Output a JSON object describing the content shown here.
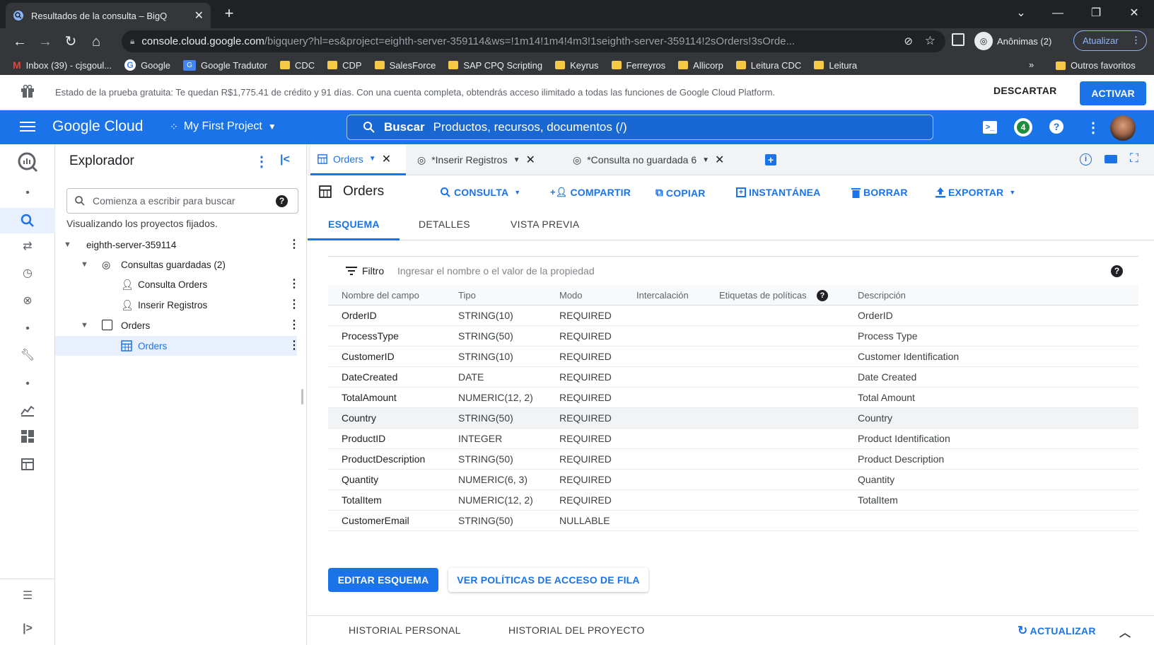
{
  "browser": {
    "tab_title": "Resultados de la consulta – BigQ",
    "url_host": "console.cloud.google.com",
    "url_path": "/bigquery?hl=es&project=eighth-server-359114&ws=!1m14!1m4!4m3!1seighth-server-359114!2sOrders!3sOrde...",
    "incognito_label": "Anônimas (2)",
    "update_label": "Atualizar",
    "bookmarks": [
      {
        "label": "Inbox (39) - cjsgoul...",
        "icon": "gmail-icon"
      },
      {
        "label": "Google",
        "icon": "google-icon"
      },
      {
        "label": "Google Tradutor",
        "icon": "translate-icon"
      },
      {
        "label": "CDC",
        "icon": "folder-icon"
      },
      {
        "label": "CDP",
        "icon": "folder-icon"
      },
      {
        "label": "SalesForce",
        "icon": "folder-icon"
      },
      {
        "label": "SAP CPQ Scripting",
        "icon": "folder-icon"
      },
      {
        "label": "Keyrus",
        "icon": "folder-icon"
      },
      {
        "label": "Ferreyros",
        "icon": "folder-icon"
      },
      {
        "label": "Allicorp",
        "icon": "folder-icon"
      },
      {
        "label": "Leitura CDC",
        "icon": "folder-icon"
      },
      {
        "label": "Leitura",
        "icon": "folder-icon"
      }
    ],
    "bookmarks_more": "»",
    "other_bookmarks": "Outros favoritos"
  },
  "banner": {
    "text": "Estado de la prueba gratuita: Te quedan R$1,775.41 de crédito y 91 días. Con una cuenta completa, obtendrás acceso ilimitado a todas las funciones de Google Cloud Platform.",
    "dismiss_label": "DESCARTAR",
    "activate_label": "ACTIVAR"
  },
  "header": {
    "brand": "Google Cloud",
    "project": "My First Project",
    "search_label": "Buscar",
    "search_placeholder": "Productos, recursos, documentos (/)",
    "notification_count": "4"
  },
  "explorer": {
    "title": "Explorador",
    "search_placeholder": "Comienza a escribir para buscar",
    "note": "Visualizando los proyectos fijados.",
    "project": "eighth-server-359114",
    "saved_queries_label": "Consultas guardadas (2)",
    "saved_queries": [
      "Consulta Orders",
      "Inserir Registros"
    ],
    "dataset": "Orders",
    "table": "Orders"
  },
  "tabs": [
    {
      "label": "Orders"
    },
    {
      "label": "*Inserir Registros"
    },
    {
      "label": "*Consulta no guardada 6"
    }
  ],
  "table_view": {
    "title": "Orders",
    "actions": {
      "query": "CONSULTA",
      "share": "COMPARTIR",
      "copy": "COPIAR",
      "snapshot": "INSTANTÁNEA",
      "delete": "BORRAR",
      "export": "EXPORTAR"
    },
    "subtabs": [
      "ESQUEMA",
      "DETALLES",
      "VISTA PREVIA"
    ],
    "filter_label": "Filtro",
    "filter_placeholder": "Ingresar el nombre o el valor de la propiedad",
    "columns": [
      "Nombre del campo",
      "Tipo",
      "Modo",
      "Intercalación",
      "Etiquetas de políticas",
      "Descripción"
    ],
    "rows": [
      {
        "name": "OrderID",
        "type": "STRING(10)",
        "mode": "REQUIRED",
        "desc": "OrderID"
      },
      {
        "name": "ProcessType",
        "type": "STRING(50)",
        "mode": "REQUIRED",
        "desc": "Process Type"
      },
      {
        "name": "CustomerID",
        "type": "STRING(10)",
        "mode": "REQUIRED",
        "desc": "Customer Identification"
      },
      {
        "name": "DateCreated",
        "type": "DATE",
        "mode": "REQUIRED",
        "desc": "Date Created"
      },
      {
        "name": "TotalAmount",
        "type": "NUMERIC(12, 2)",
        "mode": "REQUIRED",
        "desc": "Total Amount"
      },
      {
        "name": "Country",
        "type": "STRING(50)",
        "mode": "REQUIRED",
        "desc": "Country"
      },
      {
        "name": "ProductID",
        "type": "INTEGER",
        "mode": "REQUIRED",
        "desc": "Product Identification"
      },
      {
        "name": "ProductDescription",
        "type": "STRING(50)",
        "mode": "REQUIRED",
        "desc": "Product Description"
      },
      {
        "name": "Quantity",
        "type": "NUMERIC(6, 3)",
        "mode": "REQUIRED",
        "desc": "Quantity"
      },
      {
        "name": "TotalItem",
        "type": "NUMERIC(12, 2)",
        "mode": "REQUIRED",
        "desc": "TotalItem"
      },
      {
        "name": "CustomerEmail",
        "type": "STRING(50)",
        "mode": "NULLABLE",
        "desc": ""
      }
    ],
    "edit_schema_label": "EDITAR ESQUEMA",
    "row_policies_label": "VER POLÍTICAS DE ACCESO DE FILA"
  },
  "history": {
    "personal": "HISTORIAL PERSONAL",
    "project": "HISTORIAL DEL PROYECTO",
    "refresh": "ACTUALIZAR"
  },
  "colors": {
    "accent": "#1a73e8",
    "chrome_dark": "#202124",
    "chrome_toolbar": "#35363a"
  }
}
